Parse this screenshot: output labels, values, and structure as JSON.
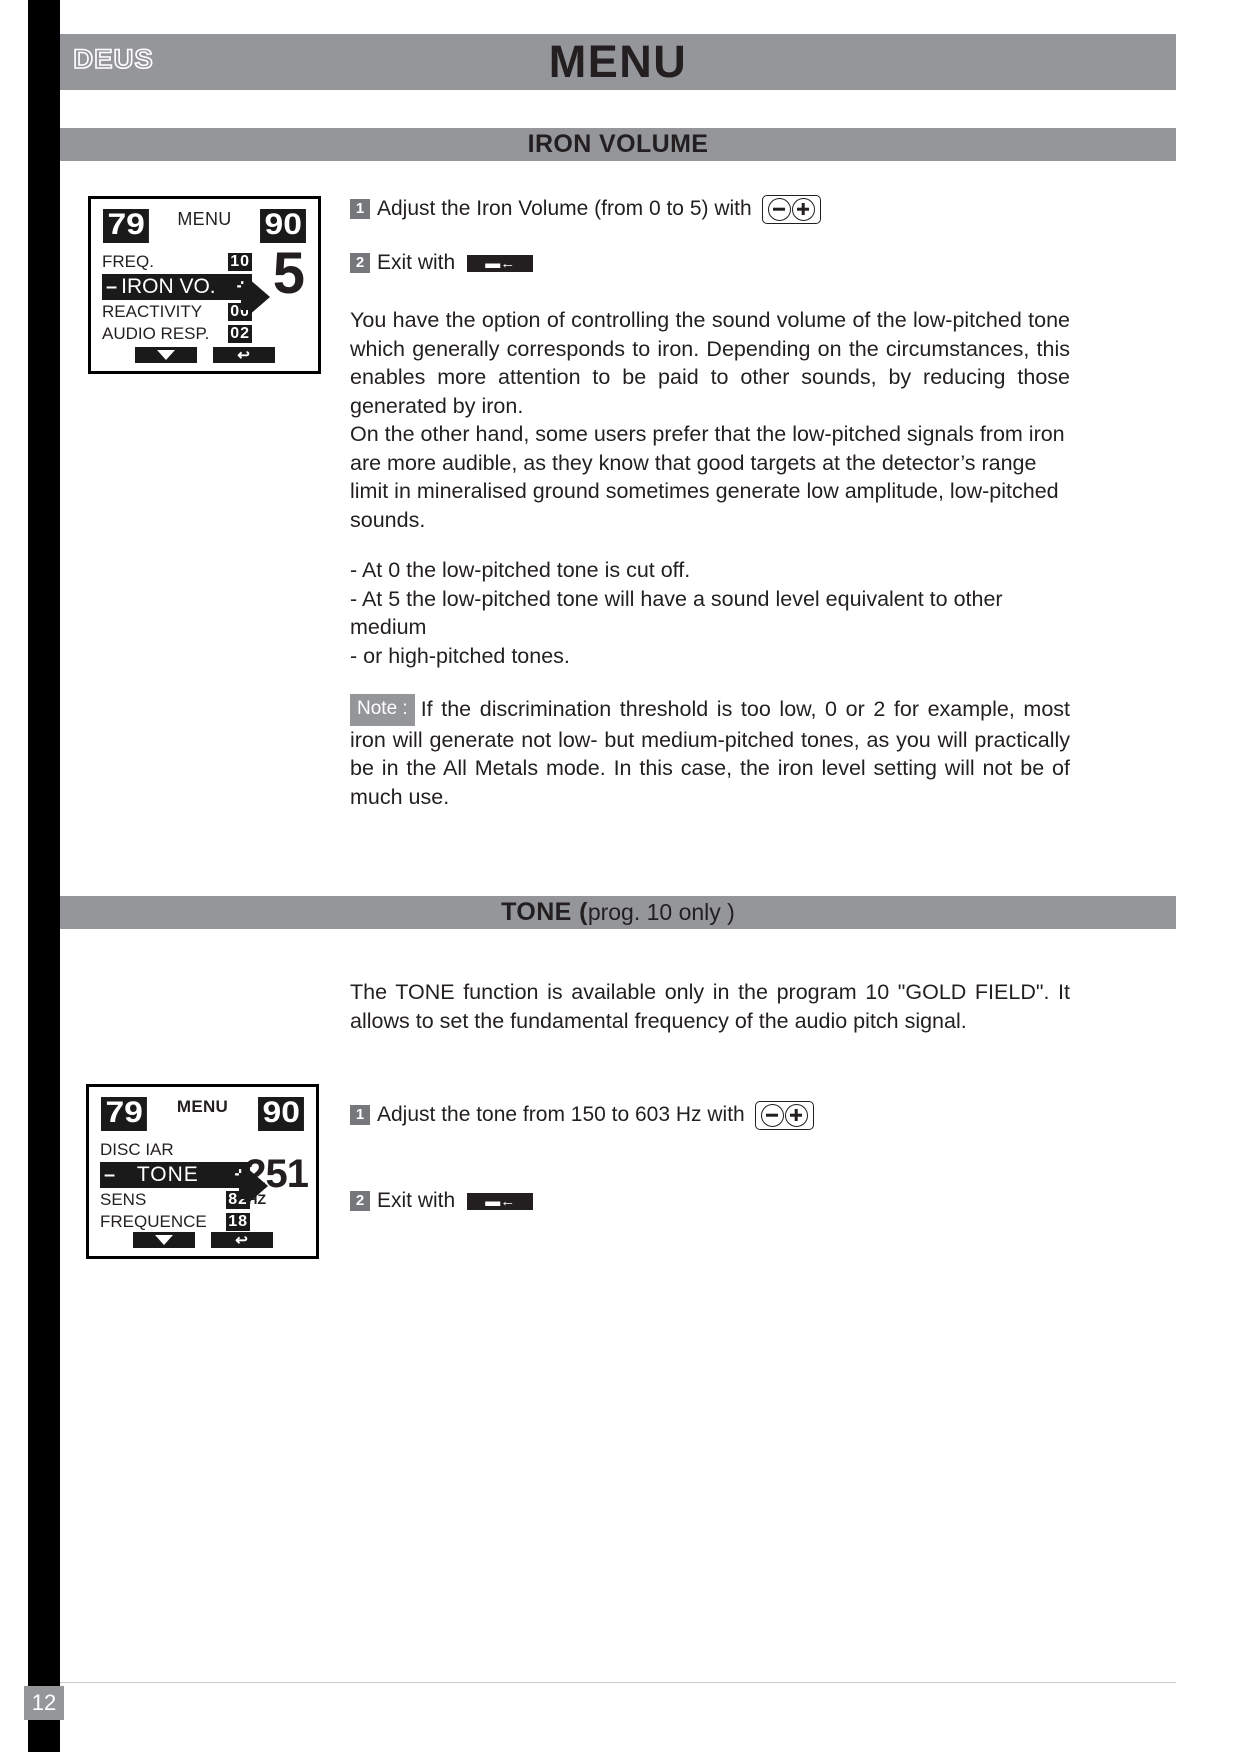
{
  "header": {
    "logo_text": "DEUS",
    "title": "MENU"
  },
  "sections": [
    {
      "id": "iron-volume",
      "band_title": "IRON VOLUME",
      "band_sub": ""
    },
    {
      "id": "tone",
      "band_title": "TONE (",
      "band_sub": " prog. 10 only )"
    }
  ],
  "iron_volume": {
    "lcd": {
      "program_left": "79",
      "program_right": "90",
      "menu_label": "MENU",
      "big_value": "5",
      "rows": [
        {
          "label": "FREQ.",
          "value": "10",
          "selected": false
        },
        {
          "label": "IRON VO.",
          "value": "",
          "selected": true
        },
        {
          "label": "REACTIVITY",
          "value": "00",
          "selected": false
        },
        {
          "label": "AUDIO RESP.",
          "value": "02",
          "selected": false
        }
      ],
      "minus_symbol": "–",
      "plus_symbol": "+",
      "softkey_down": "down-arrow",
      "softkey_back": "↩"
    },
    "step1": {
      "number": "1",
      "text": "Adjust the Iron Volume (from 0 to 5) with"
    },
    "step2": {
      "number": "2",
      "text": "Exit with",
      "glyph": "▬←"
    },
    "paragraph1": "You have the option of controlling the sound volume of the low-pitched tone which generally corresponds to iron. Depending on the circumstances, this enables more attention to be paid to other sounds, by reducing those generated by iron.",
    "paragraph2": "On the other hand, some users prefer that the low-pitched signals from iron are more audible, as they know that good targets at the detector’s range limit in mineralised ground sometimes generate low amplitude, low-pitched sounds.",
    "bullets": [
      "- At 0 the low-pitched tone is cut off.",
      "- At 5 the low-pitched tone will have a sound level equivalent to other medium",
      "- or high-pitched tones."
    ],
    "note": {
      "badge": "Note :",
      "text": "If the discrimination threshold is too low, 0 or 2 for example, most iron will generate not low- but medium-pitched tones, as you will practically be in the All Metals mode. In this case, the iron level setting will not be of much use."
    }
  },
  "tone": {
    "intro": "The TONE function is available only in the program 10  \"GOLD FIELD\". It allows to set the fundamental frequency of the audio pitch signal.",
    "lcd": {
      "program_left": "79",
      "program_right": "90",
      "menu_label": "MENU",
      "big_value": "251",
      "unit": "HZ",
      "rows": [
        {
          "label": "DISC IAR",
          "value": "",
          "selected": false
        },
        {
          "label": "TONE",
          "value": "",
          "selected": true
        },
        {
          "label": "SENS",
          "value": "82",
          "selected": false
        },
        {
          "label": "FREQUENCE",
          "value": "18",
          "selected": false
        }
      ],
      "minus_symbol": "–",
      "plus_symbol": "+",
      "softkey_down": "down-arrow",
      "softkey_back": "↩"
    },
    "step1": {
      "number": "1",
      "text": "Adjust the tone from 150 to 603 Hz  with"
    },
    "step2": {
      "number": "2",
      "text": "Exit with",
      "glyph": "▬←"
    }
  },
  "footer": {
    "page_number": "12"
  },
  "colors": {
    "band_gray": "#949699",
    "text_dark": "#231f20",
    "badge_gray": "#76777a",
    "lcd_black": "#1a1a1a"
  }
}
